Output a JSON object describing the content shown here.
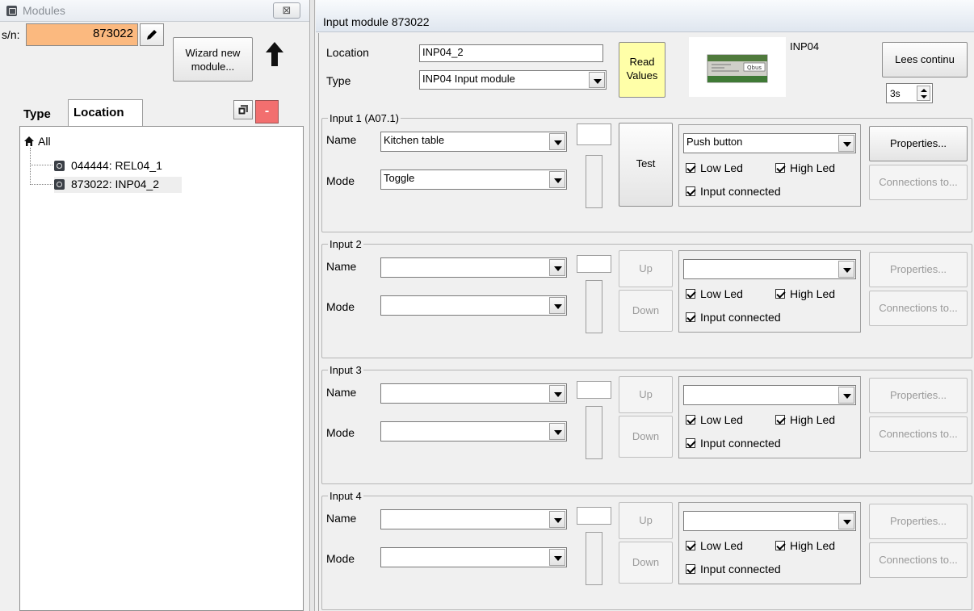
{
  "left_panel": {
    "title": "Modules",
    "close_glyph": "⊠",
    "sn_label": "s/n:",
    "sn_value": "873022",
    "wizard_line1": "Wizard new",
    "wizard_line2": "module...",
    "tabs": [
      "Type",
      "Location"
    ],
    "remove_glyph": "-",
    "tree": {
      "root": "All",
      "items": [
        "044444: REL04_1",
        "873022: INP04_2"
      ]
    }
  },
  "right_panel": {
    "title": "Input module 873022",
    "location_label": "Location",
    "location_value": "INP04_2",
    "type_label": "Type",
    "type_value": "INP04 Input module",
    "read_values_line1": "Read",
    "read_values_line2": "Values",
    "module_name": "INP04",
    "module_brand": "Qbus",
    "lees_label": "Lees continu",
    "interval_value": "3s"
  },
  "inputs": [
    {
      "title": "Input 1 (A07.1)",
      "name_label": "Name",
      "name_value": "Kitchen table",
      "mode_label": "Mode",
      "mode_value": "Toggle",
      "test_label": "Test",
      "type_value": "Push button",
      "low_led": "Low Led",
      "high_led": "High Led",
      "connected": "Input connected",
      "properties": "Properties...",
      "connections": "Connections to..."
    },
    {
      "title": "Input 2",
      "name_label": "Name",
      "name_value": "",
      "mode_label": "Mode",
      "mode_value": "",
      "up_label": "Up",
      "down_label": "Down",
      "type_value": "",
      "low_led": "Low Led",
      "high_led": "High Led",
      "connected": "Input connected",
      "properties": "Properties...",
      "connections": "Connections to..."
    },
    {
      "title": "Input 3",
      "name_label": "Name",
      "name_value": "",
      "mode_label": "Mode",
      "mode_value": "",
      "up_label": "Up",
      "down_label": "Down",
      "type_value": "",
      "low_led": "Low Led",
      "high_led": "High Led",
      "connected": "Input connected",
      "properties": "Properties...",
      "connections": "Connections to..."
    },
    {
      "title": "Input 4",
      "name_label": "Name",
      "name_value": "",
      "mode_label": "Mode",
      "mode_value": "",
      "up_label": "Up",
      "down_label": "Down",
      "type_value": "",
      "low_led": "Low Led",
      "high_led": "High Led",
      "connected": "Input connected",
      "properties": "Properties...",
      "connections": "Connections to..."
    }
  ],
  "colors": {
    "sn_field_bg": "#fbb97f",
    "read_values_bg": "#ffffa8",
    "remove_button_bg": "#f26f6f"
  },
  "icons": [
    "modules-icon",
    "close-icon",
    "pencil-icon",
    "upload-arrow-icon",
    "copy-icon",
    "remove-icon",
    "home-icon",
    "module-icon",
    "dropdown-arrow-icon",
    "checkbox-checked-icon",
    "spinner-icon"
  ]
}
